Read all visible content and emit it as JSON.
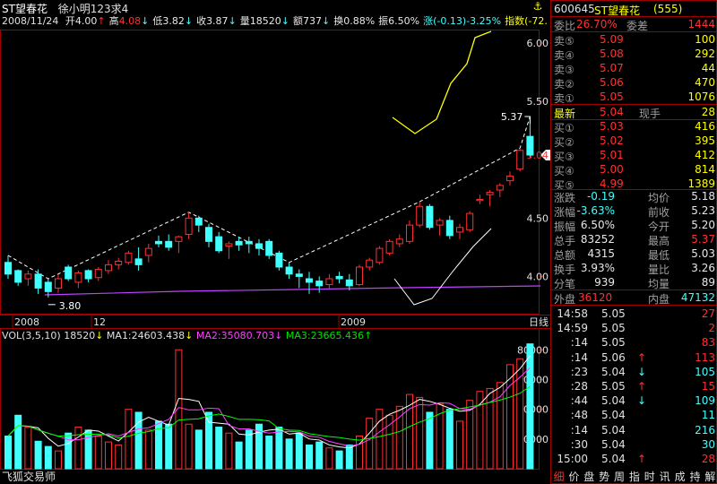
{
  "header": {
    "stock_name": "ST望春花",
    "user": "徐小明123求4",
    "date": "2008/11/24",
    "fields": [
      {
        "label": "开",
        "value": "4.00",
        "arrow": "↑",
        "color": "white"
      },
      {
        "label": "高",
        "value": "4.08",
        "arrow": "↓",
        "color": "red"
      },
      {
        "label": "低",
        "value": "3.82",
        "arrow": "↓",
        "color": "white"
      },
      {
        "label": "收",
        "value": "3.87",
        "arrow": "↓",
        "color": "white"
      },
      {
        "label": "量",
        "value": "18520",
        "arrow": "↓",
        "color": "white"
      },
      {
        "label": "额",
        "value": "737",
        "arrow": "↓",
        "color": "white"
      },
      {
        "label": "换",
        "value": "0.88%",
        "arrow": "",
        "color": "white"
      },
      {
        "label": "振",
        "value": "6.50%",
        "arrow": "",
        "color": "white"
      },
      {
        "label": "涨",
        "value": "(-0.13)-3.25%",
        "arrow": "",
        "color": "cyan"
      },
      {
        "label": "指数",
        "value": "(-72.",
        "arrow": "",
        "color": "yellow"
      }
    ]
  },
  "price_axis": {
    "ticks": [
      "6.00",
      "5.50",
      "5.04",
      "4.50",
      "4.00"
    ],
    "current": "5.04"
  },
  "price_annotations": {
    "high_label": "5.37",
    "low_label": "3.80"
  },
  "date_axis": {
    "labels": [
      "2008",
      "12",
      "2009"
    ],
    "period": "日线"
  },
  "volume": {
    "indicator": "VOL(3,5,10)",
    "value": "18520",
    "ma1_label": "MA1:",
    "ma1": "24603.438",
    "ma2_label": "MA2:",
    "ma2": "35080.703",
    "ma3_label": "MA3:",
    "ma3": "23665.436",
    "ticks": [
      "80000",
      "60000",
      "40000",
      "20000"
    ]
  },
  "watermark": "飞狐交易师",
  "side_panel": {
    "code": "600645",
    "name": "ST望春花",
    "sub": "(555)",
    "weibi_label": "委比",
    "weibi_value": "26.70%",
    "weicha_label": "委差",
    "weicha_value": "1444",
    "asks": [
      {
        "label": "卖⑤",
        "price": "5.09",
        "vol": "100"
      },
      {
        "label": "卖④",
        "price": "5.08",
        "vol": "292"
      },
      {
        "label": "卖③",
        "price": "5.07",
        "vol": "44"
      },
      {
        "label": "卖②",
        "price": "5.06",
        "vol": "470"
      },
      {
        "label": "卖①",
        "price": "5.05",
        "vol": "1076"
      }
    ],
    "latest_label": "最新",
    "latest_price": "5.04",
    "xianshou_label": "现手",
    "xianshou_value": "28",
    "bids": [
      {
        "label": "买①",
        "price": "5.03",
        "vol": "416"
      },
      {
        "label": "买②",
        "price": "5.02",
        "vol": "395"
      },
      {
        "label": "买③",
        "price": "5.01",
        "vol": "412"
      },
      {
        "label": "买④",
        "price": "5.00",
        "vol": "814"
      },
      {
        "label": "买⑤",
        "price": "4.99",
        "vol": "1389"
      }
    ],
    "stats": [
      {
        "l1": "涨跌",
        "v1": "-0.19",
        "c1": "cyan",
        "l2": "均价",
        "v2": "5.18",
        "c2": "white"
      },
      {
        "l1": "涨幅",
        "v1": "-3.63%",
        "c1": "cyan",
        "l2": "前收",
        "v2": "5.23",
        "c2": "white"
      },
      {
        "l1": "振幅",
        "v1": "6.50%",
        "c1": "white",
        "l2": "今开",
        "v2": "5.20",
        "c2": "white"
      },
      {
        "l1": "总手",
        "v1": "83252",
        "c1": "white",
        "l2": "最高",
        "v2": "5.37",
        "c2": "red"
      },
      {
        "l1": "总额",
        "v1": "4315",
        "c1": "white",
        "l2": "最低",
        "v2": "5.03",
        "c2": "white"
      },
      {
        "l1": "换手",
        "v1": "3.93%",
        "c1": "white",
        "l2": "量比",
        "v2": "3.26",
        "c2": "white"
      },
      {
        "l1": "分笔",
        "v1": "939",
        "c1": "white",
        "l2": "均量",
        "v2": "89",
        "c2": "white"
      }
    ],
    "waipan_label": "外盘",
    "waipan_value": "36120",
    "neipan_label": "内盘",
    "neipan_value": "47132",
    "trades": [
      {
        "time": "14:58",
        "price": "5.05",
        "arrow": "",
        "vol": "27",
        "color": "red"
      },
      {
        "time": "14:59",
        "price": "5.05",
        "arrow": "",
        "vol": "2",
        "color": "red"
      },
      {
        "time": ":14",
        "price": "5.05",
        "arrow": "",
        "vol": "83",
        "color": "red"
      },
      {
        "time": ":14",
        "price": "5.06",
        "arrow": "↑",
        "vol": "113",
        "color": "red"
      },
      {
        "time": ":23",
        "price": "5.04",
        "arrow": "↓",
        "vol": "105",
        "color": "cyan"
      },
      {
        "time": ":28",
        "price": "5.05",
        "arrow": "↑",
        "vol": "15",
        "color": "red"
      },
      {
        "time": ":44",
        "price": "5.04",
        "arrow": "↓",
        "vol": "109",
        "color": "cyan"
      },
      {
        "time": ":48",
        "price": "5.04",
        "arrow": "",
        "vol": "11",
        "color": "cyan"
      },
      {
        "time": ":14",
        "price": "5.04",
        "arrow": "",
        "vol": "216",
        "color": "cyan"
      },
      {
        "time": ":30",
        "price": "5.04",
        "arrow": "",
        "vol": "30",
        "color": "cyan"
      },
      {
        "time": "15:00",
        "price": "5.04",
        "arrow": "↑",
        "vol": "28",
        "color": "red"
      }
    ],
    "bottom_tabs": [
      "细",
      "价",
      "盘",
      "势",
      "周",
      "指",
      "时",
      "讯",
      "成",
      "持",
      "解"
    ]
  },
  "colors": {
    "up": "#ff3030",
    "down": "#40ffff",
    "ma1": "#ffff00",
    "ma2": "#ff40ff",
    "ma3": "#00ff00",
    "border": "#a00000"
  }
}
